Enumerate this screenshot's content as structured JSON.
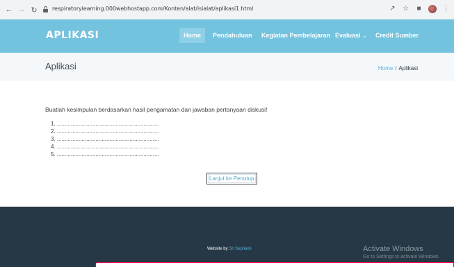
{
  "browser": {
    "url": "respiratorylearning.000webhostapp.com/Konten/alat/isialat/aplikasi1.html",
    "icons": [
      "back-icon",
      "forward-icon",
      "reload-icon",
      "lock-icon",
      "share-icon",
      "star-icon",
      "tab-icon",
      "profile-icon",
      "more-icon"
    ]
  },
  "header": {
    "brand": "APLIKASI",
    "menu": [
      {
        "label": "Home",
        "active": true
      },
      {
        "label": "Pendahuluan",
        "active": false
      },
      {
        "label": "Kegiatan Pembelajaran",
        "active": false
      },
      {
        "label": "Evaluasi",
        "active": false,
        "dropdown": true
      },
      {
        "label": "Credit Sumber",
        "active": false
      }
    ],
    "colors": {
      "bar": "#73c2de",
      "active_item": "#8dd0e7"
    }
  },
  "breadcrumb": {
    "title": "Aplikasi",
    "home": "Home",
    "separator": "/",
    "current": "Aplikasi"
  },
  "main": {
    "instruction": "Buatlah kesimpulan berdasarkan hasil pengamatan dan jawaban pertanyaan diskusi!",
    "answers": [
      "1. ..................................................................",
      "2. ..................................................................",
      "3. ..................................................................",
      "4. ..................................................................",
      "5. .................................................................."
    ],
    "continue_button": "Lanjut ke Penutup"
  },
  "footer": {
    "credit_prefix": "Website by",
    "credit_name": "Sri Septianti",
    "activate_title": "Activate Windows",
    "activate_sub": "Go to Settings to activate Windows.",
    "colors": {
      "background": "#263845",
      "link": "#5ab1d6"
    }
  }
}
